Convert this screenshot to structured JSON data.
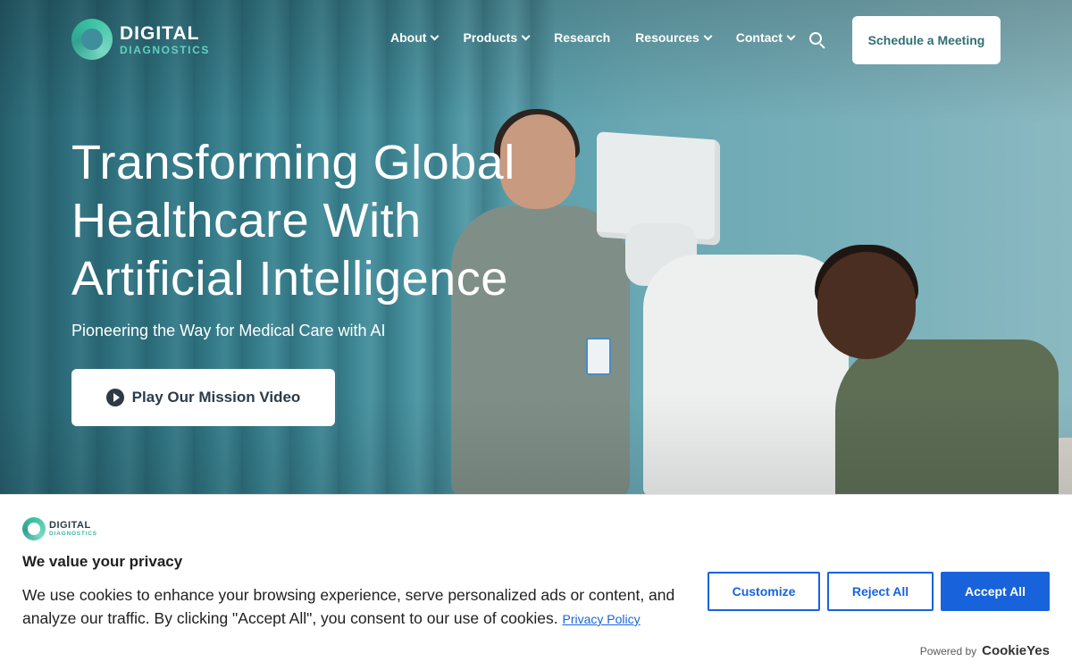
{
  "header": {
    "logo_line1": "DIGITAL",
    "logo_line2": "DIAGNOSTICS",
    "nav": [
      {
        "label": "About",
        "has_dropdown": true
      },
      {
        "label": "Products",
        "has_dropdown": true
      },
      {
        "label": "Research",
        "has_dropdown": false
      },
      {
        "label": "Resources",
        "has_dropdown": true
      },
      {
        "label": "Contact",
        "has_dropdown": true
      }
    ],
    "cta_label": "Schedule a Meeting"
  },
  "hero": {
    "title_lines": [
      "Transforming Global",
      "Healthcare With",
      "Artificial Intelligence"
    ],
    "subtitle": "Pioneering the Way for Medical Care with AI",
    "video_button_label": "Play Our Mission Video"
  },
  "cookie_banner": {
    "logo_line1": "DIGITAL",
    "logo_line2": "DIAGNOSTICS",
    "title": "We value your privacy",
    "text": "We use cookies to enhance your browsing experience, serve personalized ads or content, and analyze our traffic. By clicking \"Accept All\", you consent to our use of cookies.",
    "privacy_link": "Privacy Policy",
    "customize_label": "Customize",
    "reject_label": "Reject All",
    "accept_label": "Accept All",
    "powered_by": "Powered by",
    "powered_brand": "CookieYes"
  },
  "colors": {
    "accent_teal": "#3cc3a4",
    "cta_text": "#2f6f74",
    "cookie_blue": "#1863dc"
  }
}
